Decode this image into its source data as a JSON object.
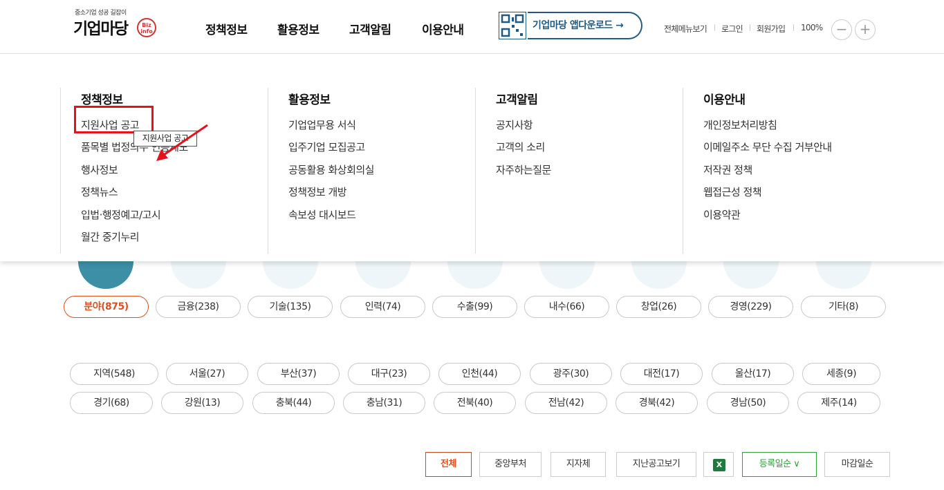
{
  "header": {
    "logo_tagline": "중소기업 성공 길잡이",
    "logo_name": "기업마당",
    "logo_badge": "Biz info",
    "nav": [
      "정책정보",
      "활용정보",
      "고객알림",
      "이용안내"
    ],
    "app_download": "기업마당 앱다운로드 →",
    "util": [
      "전체메뉴보기",
      "로그인",
      "회원가입"
    ],
    "zoom_level": "100%",
    "zoom_out": "−",
    "zoom_in": "+"
  },
  "mega_menu": {
    "columns": [
      {
        "title": "정책정보",
        "items": [
          "지원사업 공고",
          "품목별 법정의무 인증제도",
          "행사정보",
          "정책뉴스",
          "입법·행정예고/고시",
          "월간 중기누리"
        ]
      },
      {
        "title": "활용정보",
        "items": [
          "기업업무용 서식",
          "입주기업 모집공고",
          "공동활용 화상회의실",
          "정책정보 개방",
          "속보성 대시보드"
        ]
      },
      {
        "title": "고객알림",
        "items": [
          "공지사항",
          "고객의 소리",
          "자주하는질문"
        ]
      },
      {
        "title": "이용안내",
        "items": [
          "개인정보처리방침",
          "이메일주소 무단 수집 거부안내",
          "저작권 정책",
          "웹접근성 정책",
          "이용약관"
        ]
      }
    ],
    "tooltip": "지원사업 공고"
  },
  "field_filters": [
    "분야(875)",
    "금융(238)",
    "기술(135)",
    "인력(74)",
    "수출(99)",
    "내수(66)",
    "창업(26)",
    "경영(229)",
    "기타(8)"
  ],
  "region_filters_row1": [
    "지역(548)",
    "서울(27)",
    "부산(37)",
    "대구(23)",
    "인천(44)",
    "광주(30)",
    "대전(17)",
    "울산(17)",
    "세종(9)"
  ],
  "region_filters_row2": [
    "경기(68)",
    "강원(13)",
    "충북(44)",
    "충남(31)",
    "전북(40)",
    "전남(42)",
    "경북(42)",
    "경남(50)",
    "제주(14)"
  ],
  "bottom_buttons": {
    "all": "전체",
    "central": "중앙부처",
    "local": "지자체",
    "past": "지난공고보기",
    "excel": "X",
    "sort_registered": "등록일순 ∨",
    "sort_deadline": "마감일순"
  },
  "colors": {
    "accent": "#e0501c",
    "brand_blue": "#1f5a87",
    "highlight_red": "#e8101a",
    "teal": "#3d8fa6"
  }
}
